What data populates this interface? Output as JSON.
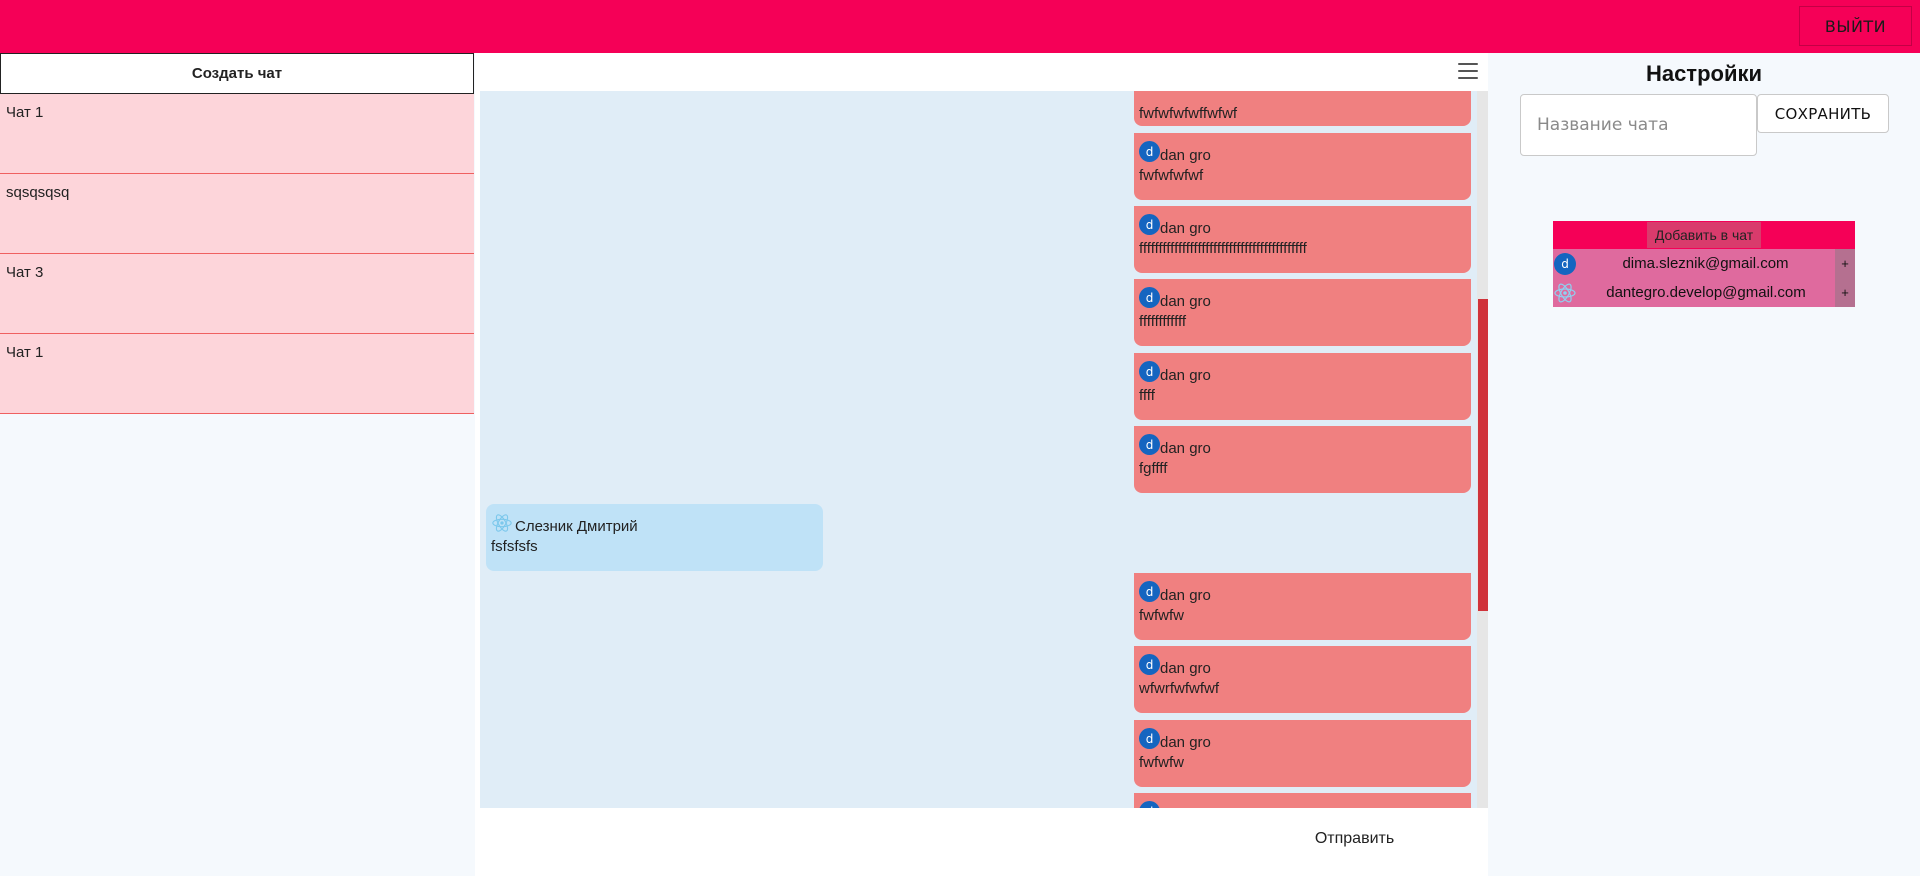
{
  "header": {
    "logout_label": "ВЫЙТИ"
  },
  "sidebar": {
    "create_chat_label": "Создать чат",
    "chats": [
      {
        "title": "Чат 1"
      },
      {
        "title": "sqsqsqsq"
      },
      {
        "title": "Чат 3"
      },
      {
        "title": "Чат 1"
      }
    ]
  },
  "messages": {
    "first_partial_text": "fwfwfwfwffwfwf",
    "outgoing": [
      {
        "avatar_letter": "d",
        "author": "dan gro",
        "text": "fwfwfwfwf"
      },
      {
        "avatar_letter": "d",
        "author": "dan gro",
        "text": "fffffffffffffffffffffffffffffffffffffffffff"
      },
      {
        "avatar_letter": "d",
        "author": "dan gro",
        "text": "ffffffffffff"
      },
      {
        "avatar_letter": "d",
        "author": "dan gro",
        "text": "ffff"
      },
      {
        "avatar_letter": "d",
        "author": "dan gro",
        "text": "fgffff"
      },
      {
        "avatar_letter": "d",
        "author": "dan gro",
        "text": "fwfwfw"
      },
      {
        "avatar_letter": "d",
        "author": "dan gro",
        "text": "wfwrfwfwfwf"
      },
      {
        "avatar_letter": "d",
        "author": "dan gro",
        "text": "fwfwfw"
      }
    ],
    "incoming": {
      "author": "Слезник Дмитрий",
      "text": "fsfsfsfs",
      "icon": "react-atom-icon"
    },
    "send_label": "Отправить"
  },
  "settings": {
    "title": "Настройки",
    "chat_name_placeholder": "Название чата",
    "save_label": "СОХРАНИТЬ",
    "add_to_chat_label": "Добавить в чат",
    "users": [
      {
        "email": "dima.sleznik@gmail.com",
        "avatar_letter": "d",
        "icon": "letter-avatar",
        "add_label": "+"
      },
      {
        "email": "dantegro.develop@gmail.com",
        "icon": "react-atom-icon",
        "add_label": "+"
      }
    ]
  },
  "colors": {
    "accent": "#f50057",
    "chat_item_bg": "#fdd5da",
    "outgoing_msg_bg": "#f08080",
    "incoming_msg_bg": "#bfe2f7",
    "messages_bg": "#e0edf7",
    "scroll_thumb": "#d0323a",
    "user_row_bg": "#df6a9e",
    "avatar_bg": "#1565c0"
  }
}
